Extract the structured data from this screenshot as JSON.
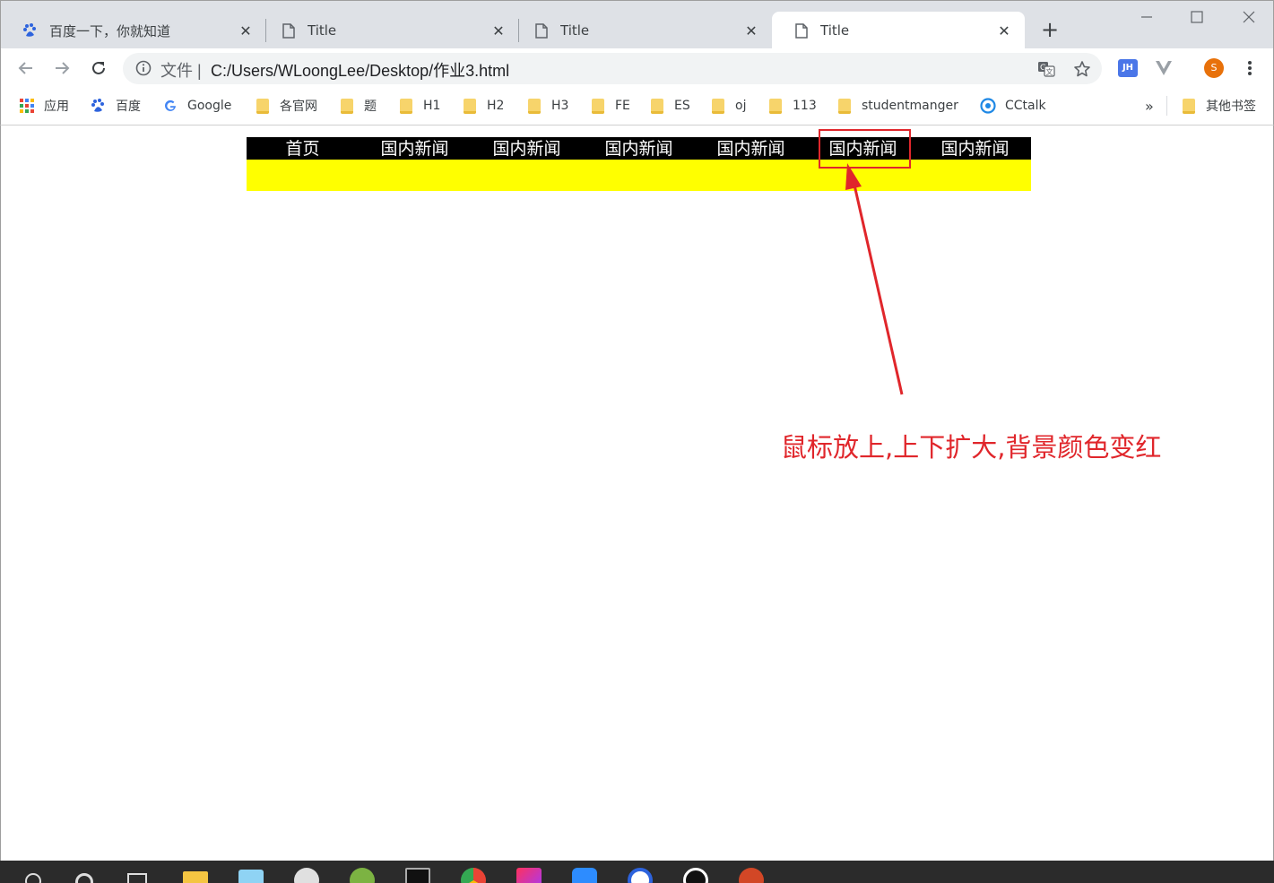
{
  "browser": {
    "tabs": [
      {
        "title": "百度一下，你就知道",
        "icon": "baidu-paw-icon",
        "active": false
      },
      {
        "title": "Title",
        "icon": "page-icon",
        "active": false
      },
      {
        "title": "Title",
        "icon": "page-icon",
        "active": false
      },
      {
        "title": "Title",
        "icon": "page-icon",
        "active": true
      }
    ],
    "tab_close_glyph": "✕",
    "new_tab_glyph": "+",
    "address": {
      "scheme_label": "文件",
      "url": "C:/Users/WLoongLee/Desktop/作业3.html"
    },
    "extensions": {
      "jh_label": "JH",
      "profile_initial": "S",
      "profile_color": "#e8710a"
    },
    "bookmarks": [
      {
        "label": "应用",
        "icon": "apps-grid-icon"
      },
      {
        "label": "百度",
        "icon": "baidu-paw-icon"
      },
      {
        "label": "Google",
        "icon": "google-g-icon"
      },
      {
        "label": "各官网",
        "icon": "folder-icon"
      },
      {
        "label": "题",
        "icon": "folder-icon"
      },
      {
        "label": "H1",
        "icon": "folder-icon"
      },
      {
        "label": "H2",
        "icon": "folder-icon"
      },
      {
        "label": "H3",
        "icon": "folder-icon"
      },
      {
        "label": "FE",
        "icon": "folder-icon"
      },
      {
        "label": "ES",
        "icon": "folder-icon"
      },
      {
        "label": "oj",
        "icon": "folder-icon"
      },
      {
        "label": "113",
        "icon": "folder-icon"
      },
      {
        "label": "studentmanger",
        "icon": "folder-icon"
      },
      {
        "label": "CCtalk",
        "icon": "cctalk-icon"
      }
    ],
    "bookmarks_overflow": "»",
    "other_bookmarks": "其他书签"
  },
  "page": {
    "nav_items": [
      "首页",
      "国内新闻",
      "国内新闻",
      "国内新闻",
      "国内新闻",
      "国内新闻",
      "国内新闻"
    ],
    "annotation": "鼠标放上,上下扩大,背景颜色变红",
    "colors": {
      "nav_background": "#000000",
      "nav_text": "#ffffff",
      "area_background": "#ffff00",
      "annotation": "#e0262b"
    }
  }
}
